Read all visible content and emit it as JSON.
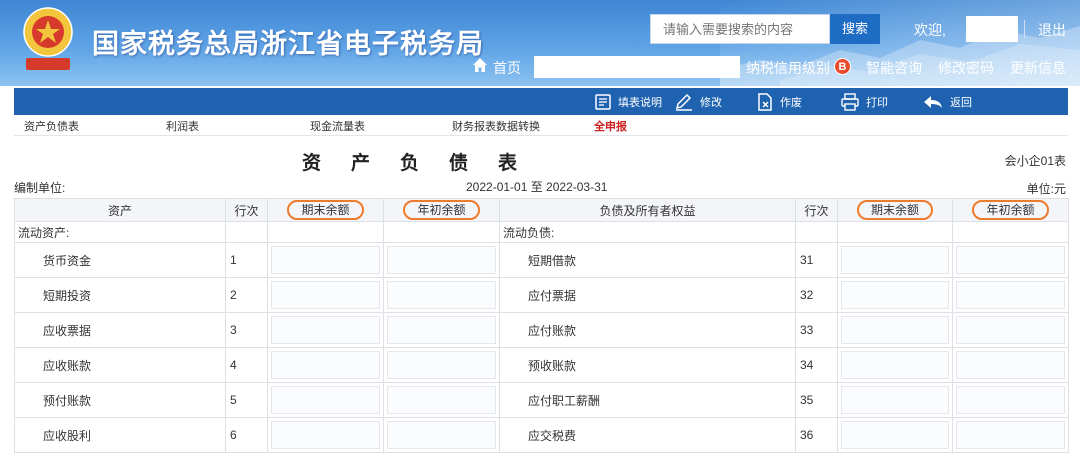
{
  "header": {
    "site_title": "国家税务总局浙江省电子税务局",
    "search_placeholder": "请输入需要搜索的内容",
    "search_button": "搜索",
    "welcome": "欢迎,",
    "logout": "退出",
    "home": "首页",
    "credit_label": "纳税信用级别",
    "credit_grade": "B",
    "nav": [
      "智能咨询",
      "修改密码",
      "更新信息"
    ],
    "brand_color": "#3e86d4"
  },
  "toolbar": {
    "items": [
      {
        "icon": "document-icon",
        "label": "填表说明"
      },
      {
        "icon": "pencil-icon",
        "label": "修改"
      },
      {
        "icon": "void-document-icon",
        "label": "作废"
      },
      {
        "icon": "printer-icon",
        "label": "打印"
      },
      {
        "icon": "back-arrow-icon",
        "label": "返回"
      }
    ],
    "color": "#1e62b0"
  },
  "tabs": [
    "资产负债表",
    "利润表",
    "现金流量表",
    "财务报表数据转换",
    "全申报"
  ],
  "report": {
    "title": "资产负债表",
    "form_code": "会小企01表",
    "unit_label": "编制单位:",
    "period": "2022-01-01 至 2022-03-31",
    "currency": "单位:元"
  },
  "table": {
    "headers": [
      "资产",
      "行次",
      "期末余额",
      "年初余额",
      "负债及所有者权益",
      "行次",
      "期末余额",
      "年初余额"
    ],
    "left_group": "流动资产:",
    "right_group": "流动负债:",
    "rows": [
      {
        "asset": "货币资金",
        "asset_line": "1",
        "liab": "短期借款",
        "liab_line": "31"
      },
      {
        "asset": "短期投资",
        "asset_line": "2",
        "liab": "应付票据",
        "liab_line": "32"
      },
      {
        "asset": "应收票据",
        "asset_line": "3",
        "liab": "应付账款",
        "liab_line": "33"
      },
      {
        "asset": "应收账款",
        "asset_line": "4",
        "liab": "预收账款",
        "liab_line": "34"
      },
      {
        "asset": "预付账款",
        "asset_line": "5",
        "liab": "应付职工薪酬",
        "liab_line": "35"
      },
      {
        "asset": "应收股利",
        "asset_line": "6",
        "liab": "应交税费",
        "liab_line": "36"
      }
    ],
    "highlight_color": "#ee7a2c"
  }
}
